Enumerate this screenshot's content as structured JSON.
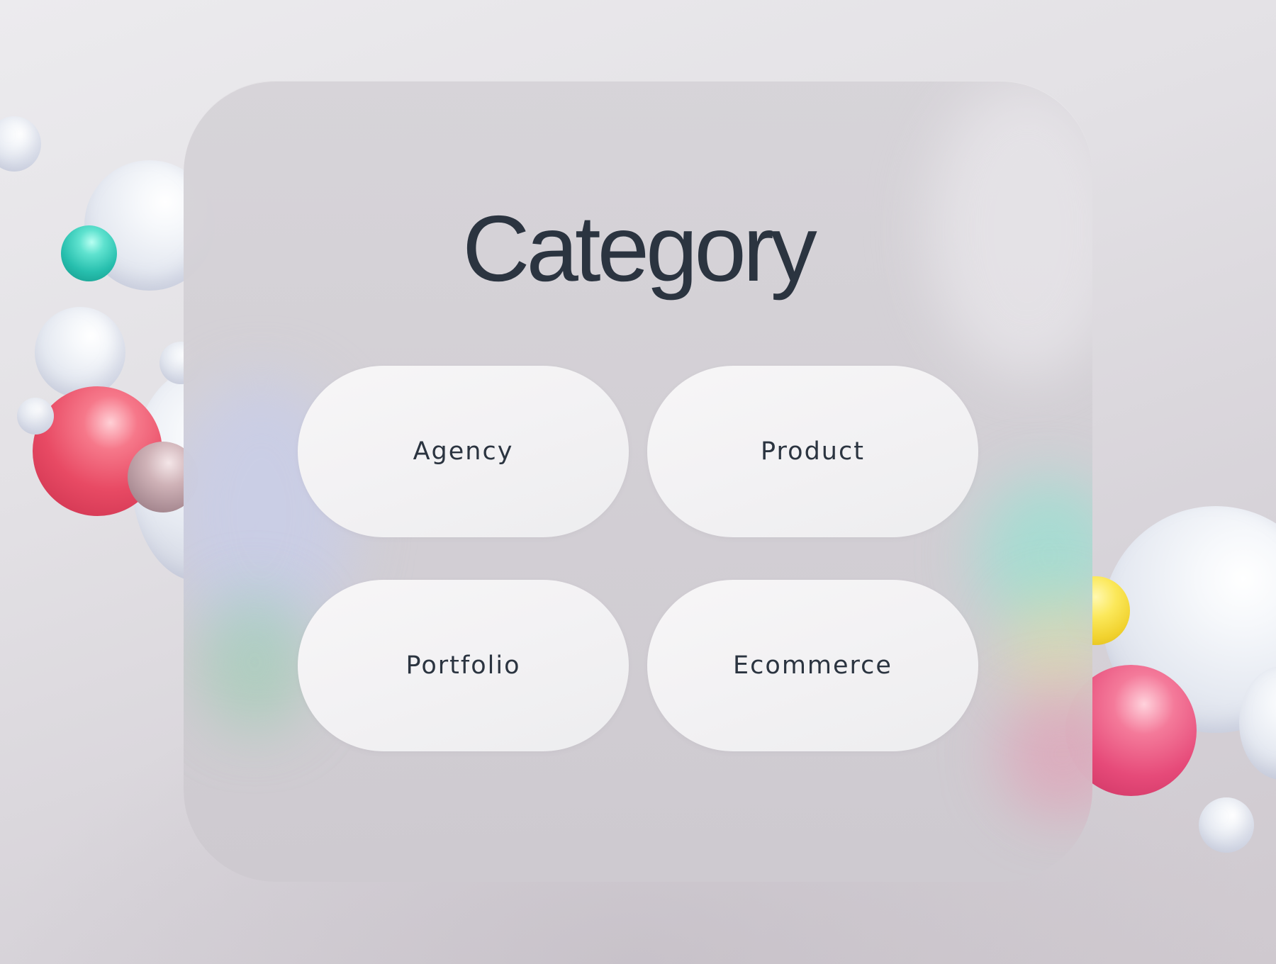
{
  "category_card": {
    "title": "Category",
    "options": [
      {
        "label": "Agency"
      },
      {
        "label": "Product"
      },
      {
        "label": "Portfolio"
      },
      {
        "label": "Ecommerce"
      }
    ]
  },
  "decoration": {
    "background_color": "#e3e1e5",
    "card_color": "#d3d0d5",
    "text_color": "#2b3440",
    "sphere_colors": {
      "white": "#eef1f6",
      "teal": "#27bfae",
      "red": "#e84a64",
      "pink": "#e64a79",
      "mauve": "#a88a92",
      "yellow": "#f1d22e"
    }
  }
}
